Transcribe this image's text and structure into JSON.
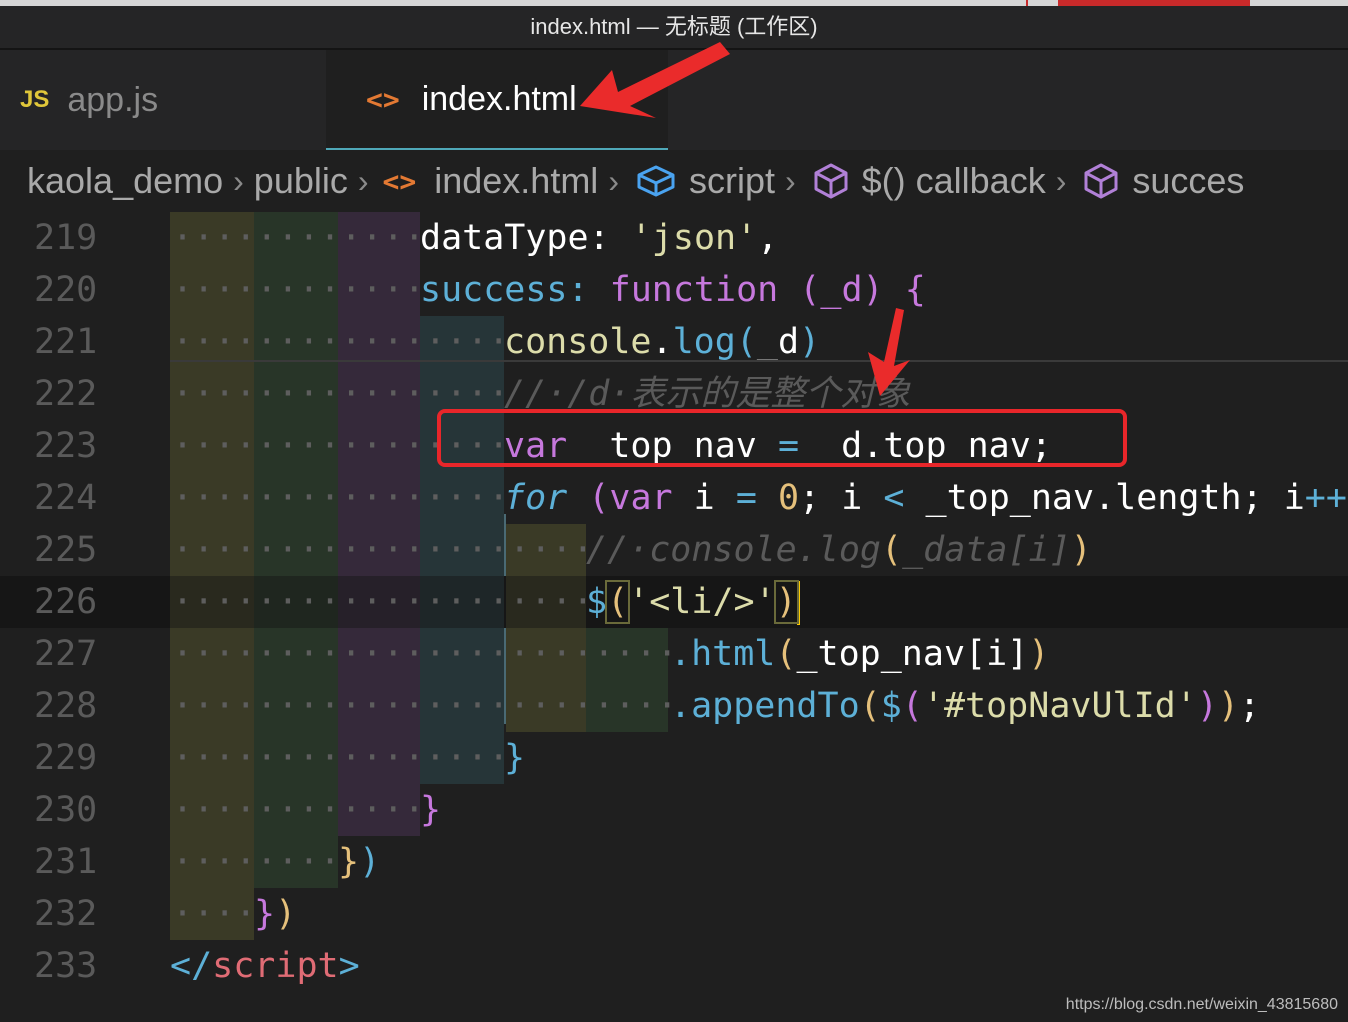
{
  "window": {
    "title": "index.html — 无标题 (工作区)"
  },
  "tabs": [
    {
      "badge": "JS",
      "label": "app.js",
      "active": false
    },
    {
      "icon": "<>",
      "label": "index.html",
      "active": true
    }
  ],
  "breadcrumb": {
    "items": [
      "kaola_demo",
      "public",
      "index.html",
      "script",
      "$() callback",
      "succes"
    ],
    "html_icon": "<>",
    "separator": ">"
  },
  "editor": {
    "line_numbers": [
      "219",
      "220",
      "221",
      "222",
      "223",
      "224",
      "225",
      "226",
      "227",
      "228",
      "229",
      "230",
      "231",
      "232",
      "233"
    ],
    "current_line": "226",
    "highlighted_line": "223"
  },
  "code": {
    "l219": {
      "a": "dataType:",
      "b": " 'json'",
      "c": ","
    },
    "l220": {
      "a": "success:",
      "b": " function",
      "c": " (",
      "d": "_d",
      "e": ")",
      "f": " {"
    },
    "l221": {
      "a": "console",
      "b": ".",
      "c": "log",
      "d": "(",
      "e": "_d",
      "f": ")"
    },
    "l222": {
      "a": "//·/d·表示的是整个对象"
    },
    "l223": {
      "a": "var",
      "b": " _top_nav",
      "c": " = ",
      "d": "_d.top_nav;"
    },
    "l224": {
      "a": "for",
      "b": " (",
      "c": "var",
      "d": " i",
      "e": " = ",
      "f": "0",
      "g": "; i ",
      "h": "<",
      "i": " _top_nav.length; i",
      "j": "++",
      "k": ")"
    },
    "l225": {
      "a": "//·console.log",
      "b": "(",
      "c": "_data[i]",
      "d": ")"
    },
    "l226": {
      "a": "$",
      "b": "(",
      "c": "'<li/>'",
      "d": ")"
    },
    "l227": {
      "a": ".html",
      "b": "(",
      "c": "_top_nav[i]",
      "d": ")"
    },
    "l228": {
      "a": ".appendTo",
      "b": "(",
      "c": "$",
      "d": "(",
      "e": "'#topNavUlId'",
      "f": ")",
      "g": ")",
      "h": ";"
    },
    "l229": {
      "a": "}"
    },
    "l230": {
      "a": "}"
    },
    "l231": {
      "a": "}",
      "b": ")"
    },
    "l232": {
      "a": "}",
      "b": ")"
    },
    "l233": {
      "a": "</",
      "b": "script",
      "c": ">"
    }
  },
  "watermark": "https://blog.csdn.net/weixin_43815680",
  "colors": {
    "background": "#1f1f1f",
    "accent_tab_border": "#4fa8b8",
    "annotation_red": "#e8262a",
    "cursor": "#ffcc00"
  }
}
